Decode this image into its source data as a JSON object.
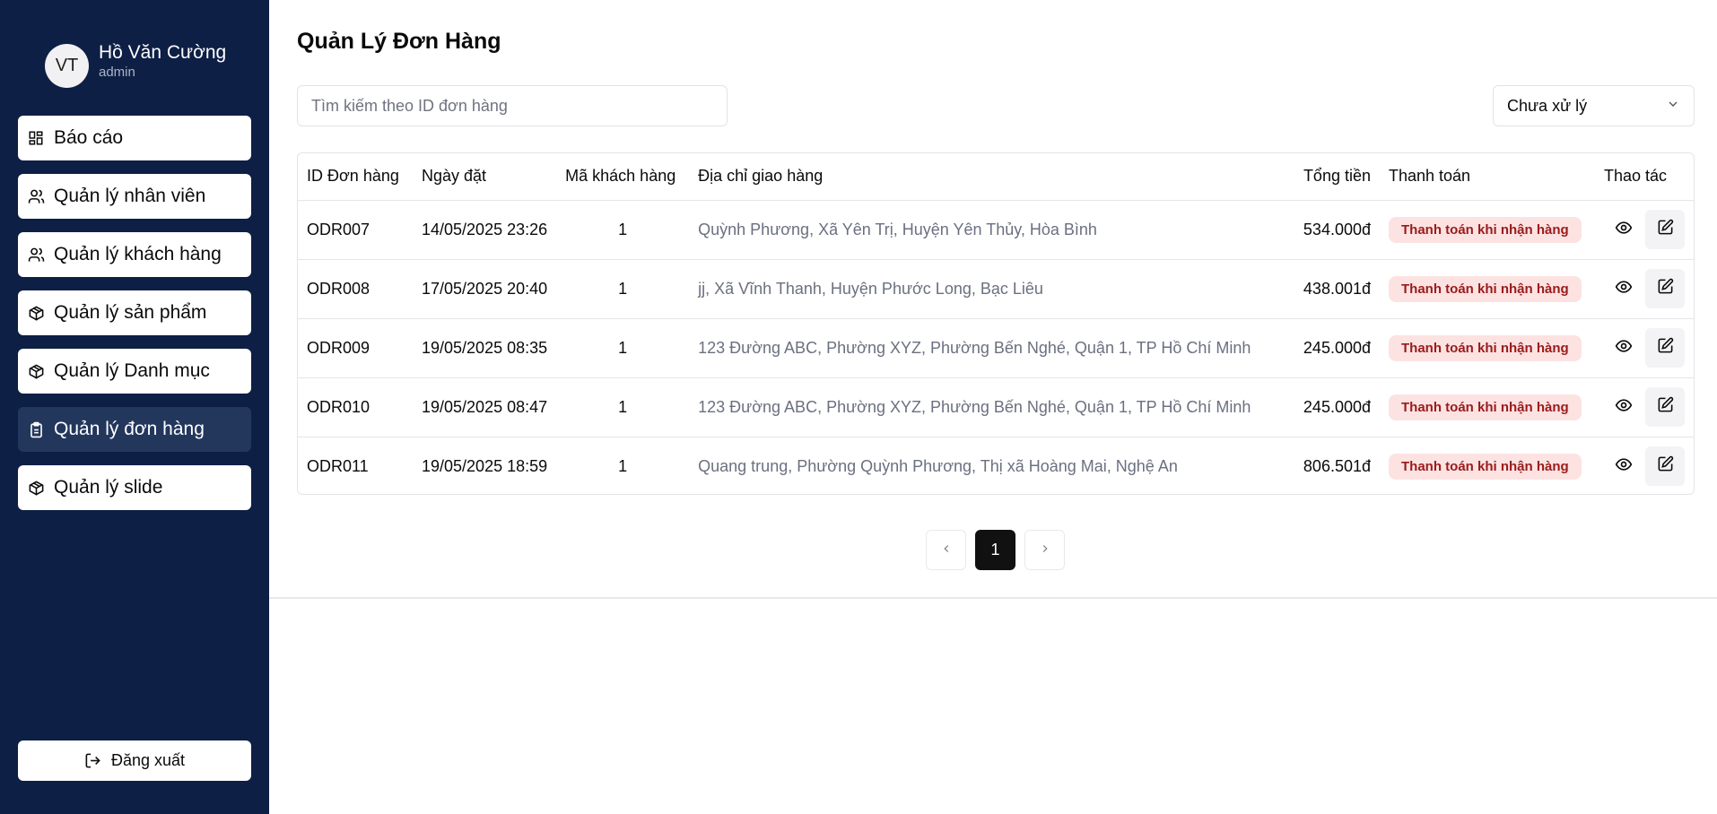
{
  "sidebar": {
    "avatar_initials": "VT",
    "user_name": "Hồ Văn Cường",
    "user_role": "admin",
    "items": [
      {
        "label": "Báo cáo",
        "icon": "dashboard-icon"
      },
      {
        "label": "Quản lý nhân viên",
        "icon": "users-icon"
      },
      {
        "label": "Quản lý khách hàng",
        "icon": "users-icon"
      },
      {
        "label": "Quản lý sản phẩm",
        "icon": "package-icon"
      },
      {
        "label": "Quản lý Danh mục",
        "icon": "package-icon"
      },
      {
        "label": "Quản lý đơn hàng",
        "icon": "clipboard-icon",
        "active": true
      },
      {
        "label": "Quản lý slide",
        "icon": "package-icon"
      }
    ],
    "logout_label": "Đăng xuất",
    "background_color": "#0e1f45",
    "active_color": "#23375d"
  },
  "main": {
    "title": "Quản Lý Đơn Hàng",
    "search": {
      "placeholder": "Tìm kiếm theo ID đơn hàng",
      "value": ""
    },
    "status_filter": {
      "selected": "Chưa xử lý"
    },
    "table": {
      "headers": {
        "id": "ID Đơn hàng",
        "date": "Ngày đặt",
        "customer": "Mã khách hàng",
        "address": "Địa chỉ giao hàng",
        "total": "Tổng tiền",
        "payment": "Thanh toán",
        "actions": "Thao tác"
      },
      "rows": [
        {
          "id": "ODR007",
          "date": "14/05/2025 23:26",
          "customer": "1",
          "address": "Quỳnh Phương, Xã Yên Trị, Huyện Yên Thủy, Hòa Bình",
          "total": "534.000đ",
          "payment": "Thanh toán khi nhận hàng"
        },
        {
          "id": "ODR008",
          "date": "17/05/2025 20:40",
          "customer": "1",
          "address": "jj, Xã Vĩnh Thanh, Huyện Phước Long, Bạc Liêu",
          "total": "438.001đ",
          "payment": "Thanh toán khi nhận hàng"
        },
        {
          "id": "ODR009",
          "date": "19/05/2025 08:35",
          "customer": "1",
          "address": "123 Đường ABC, Phường XYZ, Phường Bến Nghé, Quận 1, TP Hồ Chí Minh",
          "total": "245.000đ",
          "payment": "Thanh toán khi nhận hàng"
        },
        {
          "id": "ODR010",
          "date": "19/05/2025 08:47",
          "customer": "1",
          "address": "123 Đường ABC, Phường XYZ, Phường Bến Nghé, Quận 1, TP Hồ Chí Minh",
          "total": "245.000đ",
          "payment": "Thanh toán khi nhận hàng"
        },
        {
          "id": "ODR011",
          "date": "19/05/2025 18:59",
          "customer": "1",
          "address": "Quang trung, Phường Quỳnh Phương, Thị xã Hoàng Mai, Nghệ An",
          "total": "806.501đ",
          "payment": "Thanh toán khi nhận hàng"
        }
      ]
    },
    "pagination": {
      "current_page": "1"
    }
  }
}
